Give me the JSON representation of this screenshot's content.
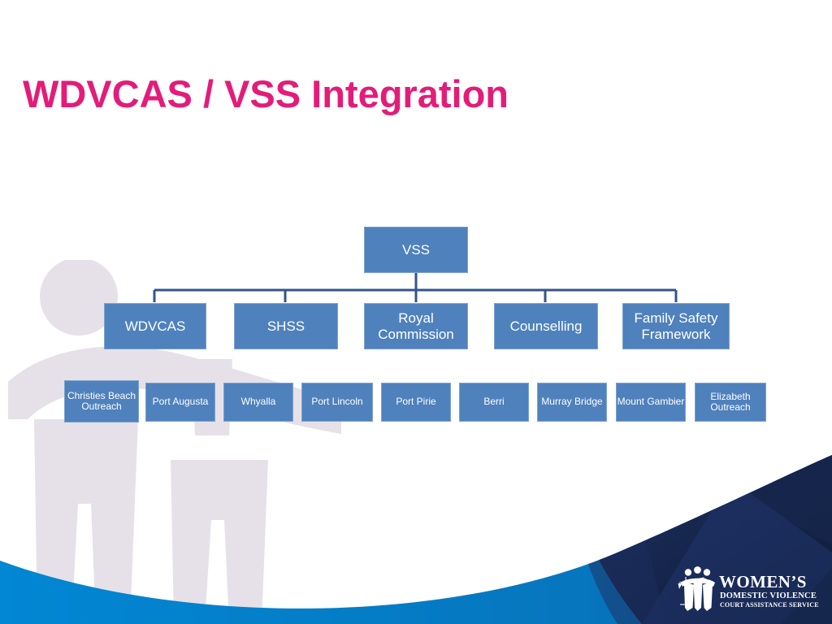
{
  "slide": {
    "title": "WDVCAS / VSS Integration",
    "title_color": "#E31C79",
    "background_color": "#FFFFFF"
  },
  "colors": {
    "node_fill": "#4F81BD",
    "node_border": "#7BA2CE",
    "node_text": "#FFFFFF",
    "connector": "#33548B",
    "wave_bright_blue": "#0583CE",
    "wave_navy": "#1A2A52",
    "watermark": "#E6E1E8"
  },
  "chart_data": {
    "type": "diagram",
    "title": "WDVCAS / VSS Integration",
    "root": {
      "id": "vss",
      "label": "VSS"
    },
    "level1": [
      {
        "id": "wdvcas",
        "label": "WDVCAS"
      },
      {
        "id": "shss",
        "label": "SHSS"
      },
      {
        "id": "royal-commission",
        "label": "Royal Commission"
      },
      {
        "id": "counselling",
        "label": "Counselling"
      },
      {
        "id": "family-safety-framework",
        "label": "Family Safety Framework"
      }
    ],
    "level2": [
      {
        "id": "christies-beach-outreach",
        "label": "Christies Beach Outreach"
      },
      {
        "id": "port-augusta",
        "label": "Port Augusta"
      },
      {
        "id": "whyalla",
        "label": "Whyalla"
      },
      {
        "id": "port-lincoln",
        "label": "Port Lincoln"
      },
      {
        "id": "port-pirie",
        "label": "Port Pirie"
      },
      {
        "id": "berri",
        "label": "Berri"
      },
      {
        "id": "murray-bridge",
        "label": "Murray Bridge"
      },
      {
        "id": "mount-gambier",
        "label": "Mount Gambier"
      },
      {
        "id": "elizabeth-outreach",
        "label": "Elizabeth Outreach"
      }
    ],
    "edges": [
      {
        "from": "vss",
        "to": "wdvcas"
      },
      {
        "from": "vss",
        "to": "shss"
      },
      {
        "from": "vss",
        "to": "royal-commission"
      },
      {
        "from": "vss",
        "to": "counselling"
      },
      {
        "from": "vss",
        "to": "family-safety-framework"
      }
    ]
  },
  "logo": {
    "line1": "WOMEN’S",
    "line2": "DOMESTIC VIOLENCE",
    "line3": "COURT ASSISTANCE SERVICE"
  }
}
